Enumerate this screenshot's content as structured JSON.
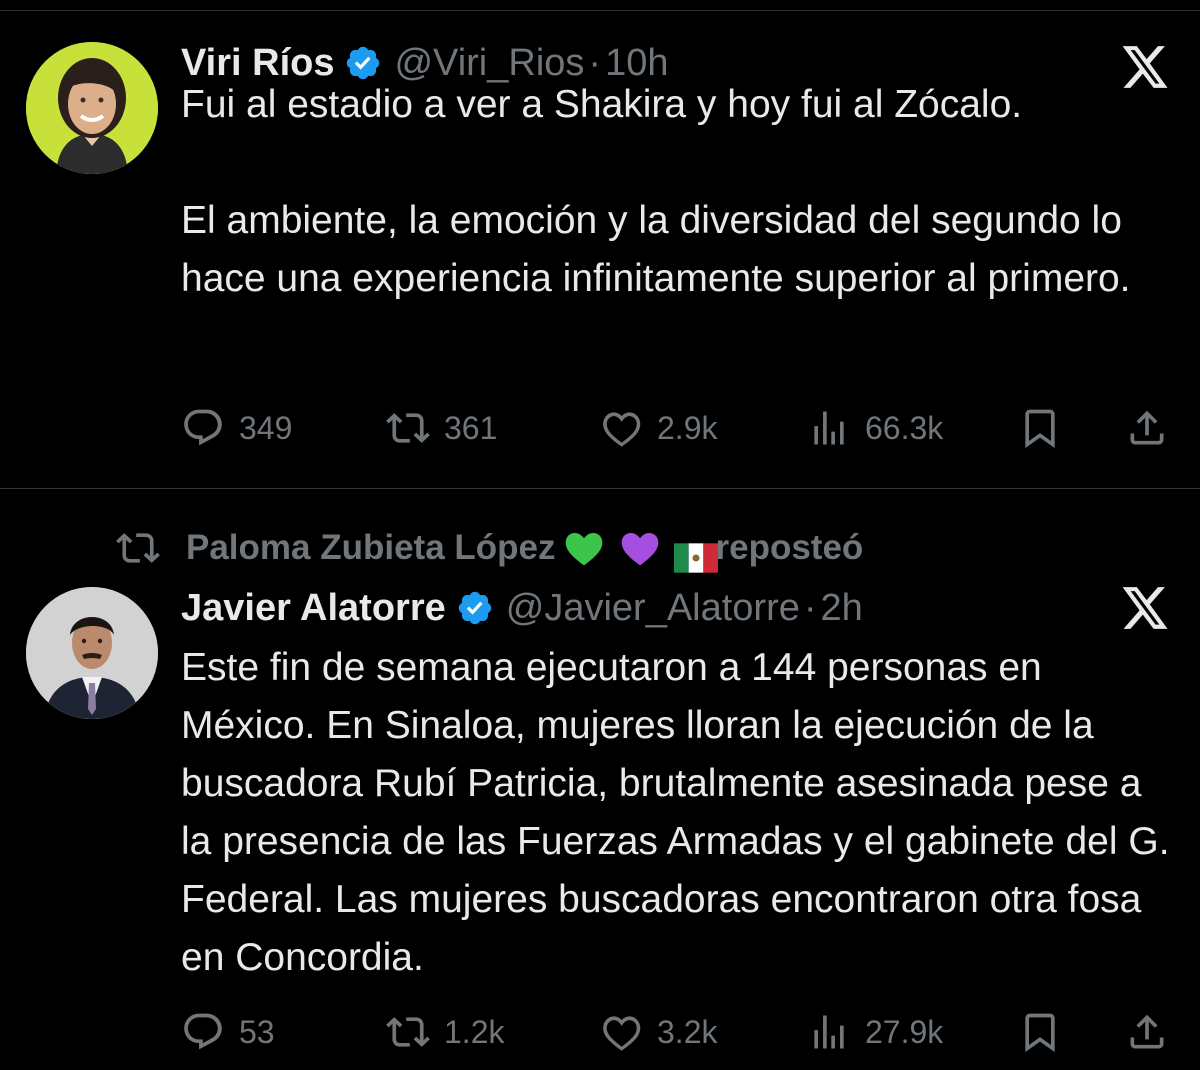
{
  "tweets": [
    {
      "name": "Viri Ríos",
      "handle": "@Viri_Rios",
      "dot": "·",
      "time": "10h",
      "text": "Fui al estadio a ver a Shakira y hoy fui al Zócalo.\n\nEl ambiente, la emoción y la diversidad del segundo lo hace una experiencia infinitamente superior al primero.",
      "replies": "349",
      "reposts": "361",
      "likes": "2.9k",
      "views": "66.3k"
    },
    {
      "reposted_by": "Paloma Zubieta López",
      "reposted_label": "reposteó",
      "name": "Javier Alatorre",
      "handle": "@Javier_Alatorre",
      "dot": "·",
      "time": "2h",
      "text": "Este fin de semana ejecutaron a 144 personas en México. En Sinaloa, mujeres lloran la ejecución de la buscadora Rubí Patricia, brutalmente asesinada pese a la presencia de las Fuerzas Armadas y el gabinete del G. Federal. Las mujeres buscadoras encontraron otra fosa en Concordia.",
      "replies": "53",
      "reposts": "1.2k",
      "likes": "3.2k",
      "views": "27.9k"
    }
  ],
  "icons": {
    "verified": "verified-badge-icon",
    "platform": "x-logo-icon",
    "reply": "reply-bubble-icon",
    "repost": "repost-arrows-icon",
    "like": "heart-icon",
    "views": "views-bars-icon",
    "bookmark": "bookmark-icon",
    "share": "share-upload-icon"
  },
  "colors": {
    "background": "#000000",
    "text": "#e7e9ea",
    "muted": "#71767b",
    "verified": "#1d9bf0",
    "divider": "#2f3336",
    "green_heart": "#3cc54a",
    "purple_heart": "#a54fe0"
  }
}
